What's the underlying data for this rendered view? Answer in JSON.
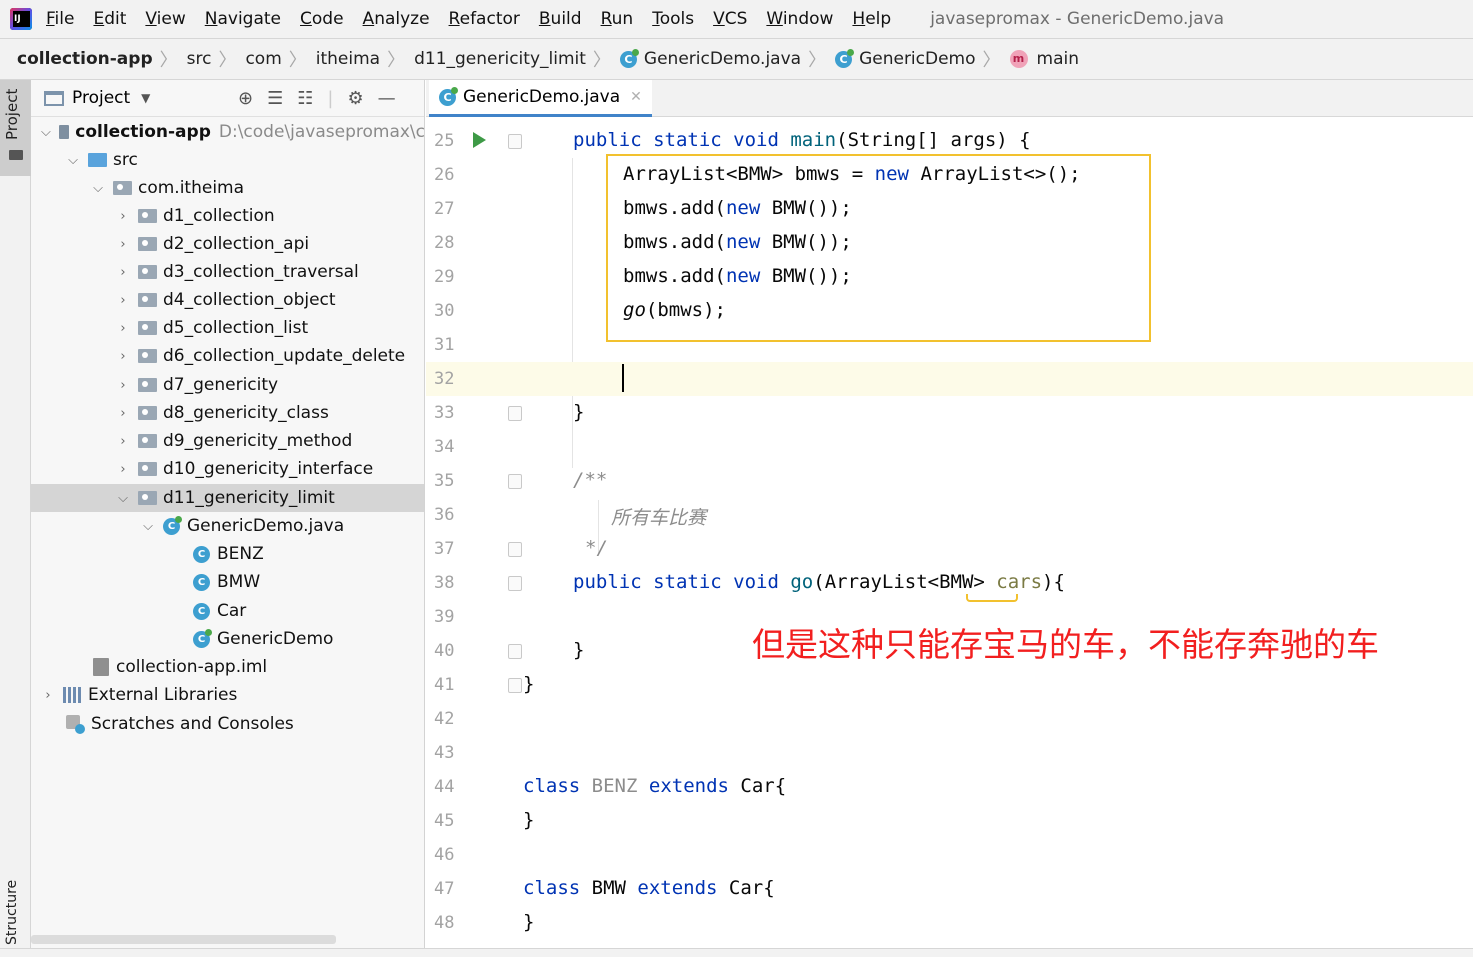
{
  "menubar": {
    "items": [
      "File",
      "Edit",
      "View",
      "Navigate",
      "Code",
      "Analyze",
      "Refactor",
      "Build",
      "Run",
      "Tools",
      "VCS",
      "Window",
      "Help"
    ],
    "window_title": "javasepromax - GenericDemo.java"
  },
  "breadcrumb": [
    "collection-app",
    "src",
    "com",
    "itheima",
    "d11_genericity_limit",
    "GenericDemo.java",
    "GenericDemo",
    "main"
  ],
  "sidebar": {
    "project_tab": "Project",
    "structure_tab": "Structure"
  },
  "project_panel": {
    "title": "Project",
    "tree": [
      {
        "label": "collection-app",
        "path": "D:\\code\\javasepromax\\c"
      },
      {
        "label": "src"
      },
      {
        "label": "com.itheima"
      },
      {
        "label": "d1_collection"
      },
      {
        "label": "d2_collection_api"
      },
      {
        "label": "d3_collection_traversal"
      },
      {
        "label": "d4_collection_object"
      },
      {
        "label": "d5_collection_list"
      },
      {
        "label": "d6_collection_update_delete"
      },
      {
        "label": "d7_genericity"
      },
      {
        "label": "d8_genericity_class"
      },
      {
        "label": "d9_genericity_method"
      },
      {
        "label": "d10_genericity_interface"
      },
      {
        "label": "d11_genericity_limit"
      },
      {
        "label": "GenericDemo.java"
      },
      {
        "label": "BENZ"
      },
      {
        "label": "BMW"
      },
      {
        "label": "Car"
      },
      {
        "label": "GenericDemo"
      },
      {
        "label": "collection-app.iml"
      },
      {
        "label": "External Libraries"
      },
      {
        "label": "Scratches and Consoles"
      }
    ]
  },
  "editor": {
    "tab_label": "GenericDemo.java",
    "line_numbers": [
      "25",
      "26",
      "27",
      "28",
      "29",
      "30",
      "31",
      "32",
      "33",
      "34",
      "35",
      "36",
      "37",
      "38",
      "39",
      "40",
      "41",
      "42",
      "43",
      "44",
      "45",
      "46",
      "47",
      "48"
    ],
    "annotation": "但是这种只能存宝马的车，不能存奔驰的车"
  },
  "colors": {
    "keyword": "#0033b3",
    "method": "#00627a",
    "comment": "#8c8c8c",
    "highlight": "#f2c12e",
    "annotation": "#f21f1f"
  }
}
